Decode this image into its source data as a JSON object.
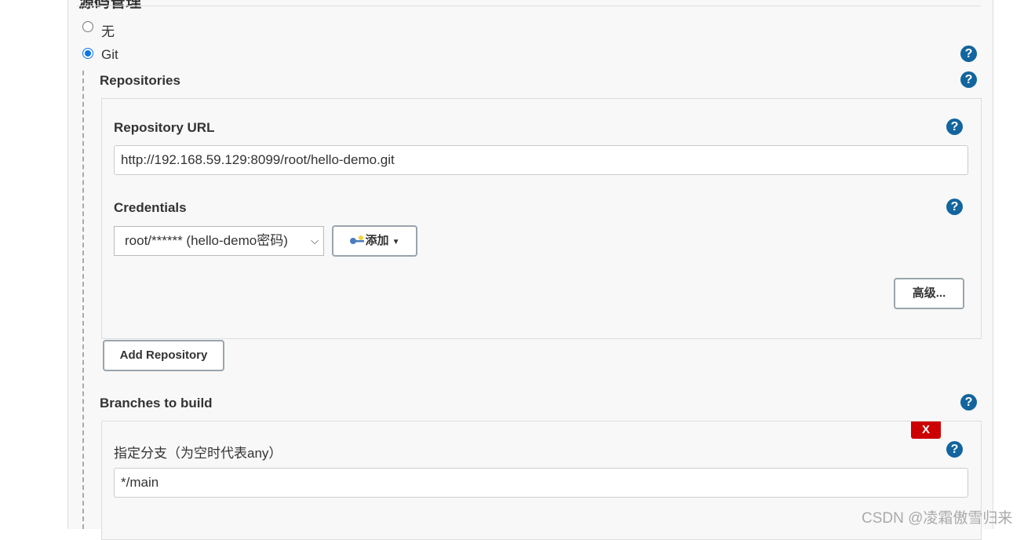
{
  "section_heading": "源码管理",
  "scm_options": [
    {
      "label": "无",
      "selected": false
    },
    {
      "label": "Git",
      "selected": true
    }
  ],
  "repositories": {
    "label": "Repositories",
    "url_label": "Repository URL",
    "url_value": "http://192.168.59.129:8099/root/hello-demo.git",
    "credentials_label": "Credentials",
    "credentials_value": "root/****** (hello-demo密码)",
    "add_label": "添加",
    "advanced_label": "高级...",
    "add_repository_label": "Add Repository"
  },
  "branches": {
    "label": "Branches to build",
    "delete_label": "X",
    "specifier_label": "指定分支（为空时代表any）",
    "specifier_value": "*/main"
  },
  "help_glyph": "?",
  "watermark": "CSDN @凌霜傲雪归来",
  "colors": {
    "help": "#12659e",
    "delete": "#cc0000",
    "radio": "#0a74e6"
  }
}
